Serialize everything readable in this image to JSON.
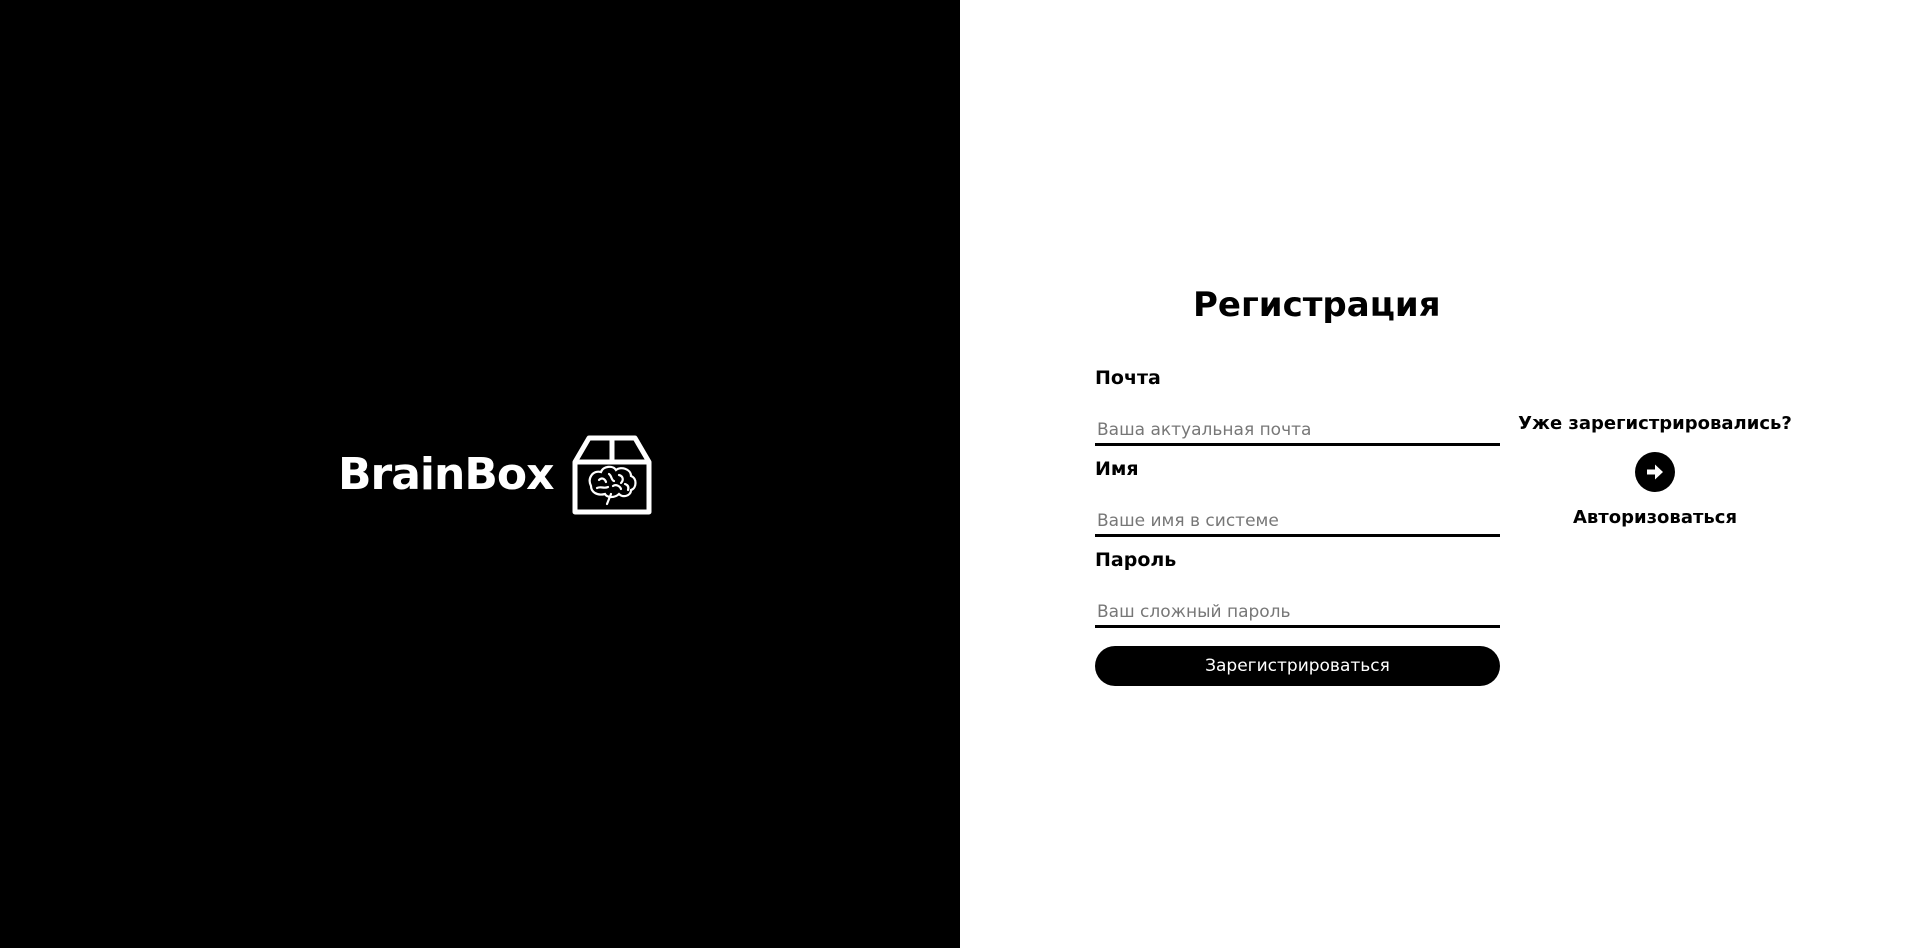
{
  "brand": {
    "name": "BrainBox",
    "logo_icon": "brain-in-box-icon"
  },
  "form": {
    "title": "Регистрация",
    "fields": [
      {
        "label": "Почта",
        "placeholder": "Ваша актуальная почта",
        "value": ""
      },
      {
        "label": "Имя",
        "placeholder": "Ваше имя в системе",
        "value": ""
      },
      {
        "label": "Пароль",
        "placeholder": "Ваш сложный пароль",
        "value": ""
      }
    ],
    "submit_label": "Зарегистрироваться"
  },
  "login": {
    "question": "Уже зарегистрировались?",
    "arrow_icon": "arrow-right-circle-icon",
    "link_label": "Авторизоваться"
  },
  "colors": {
    "left_panel": "#000000",
    "right_panel": "#ffffff",
    "accent": "#000000",
    "placeholder": "#777777"
  }
}
